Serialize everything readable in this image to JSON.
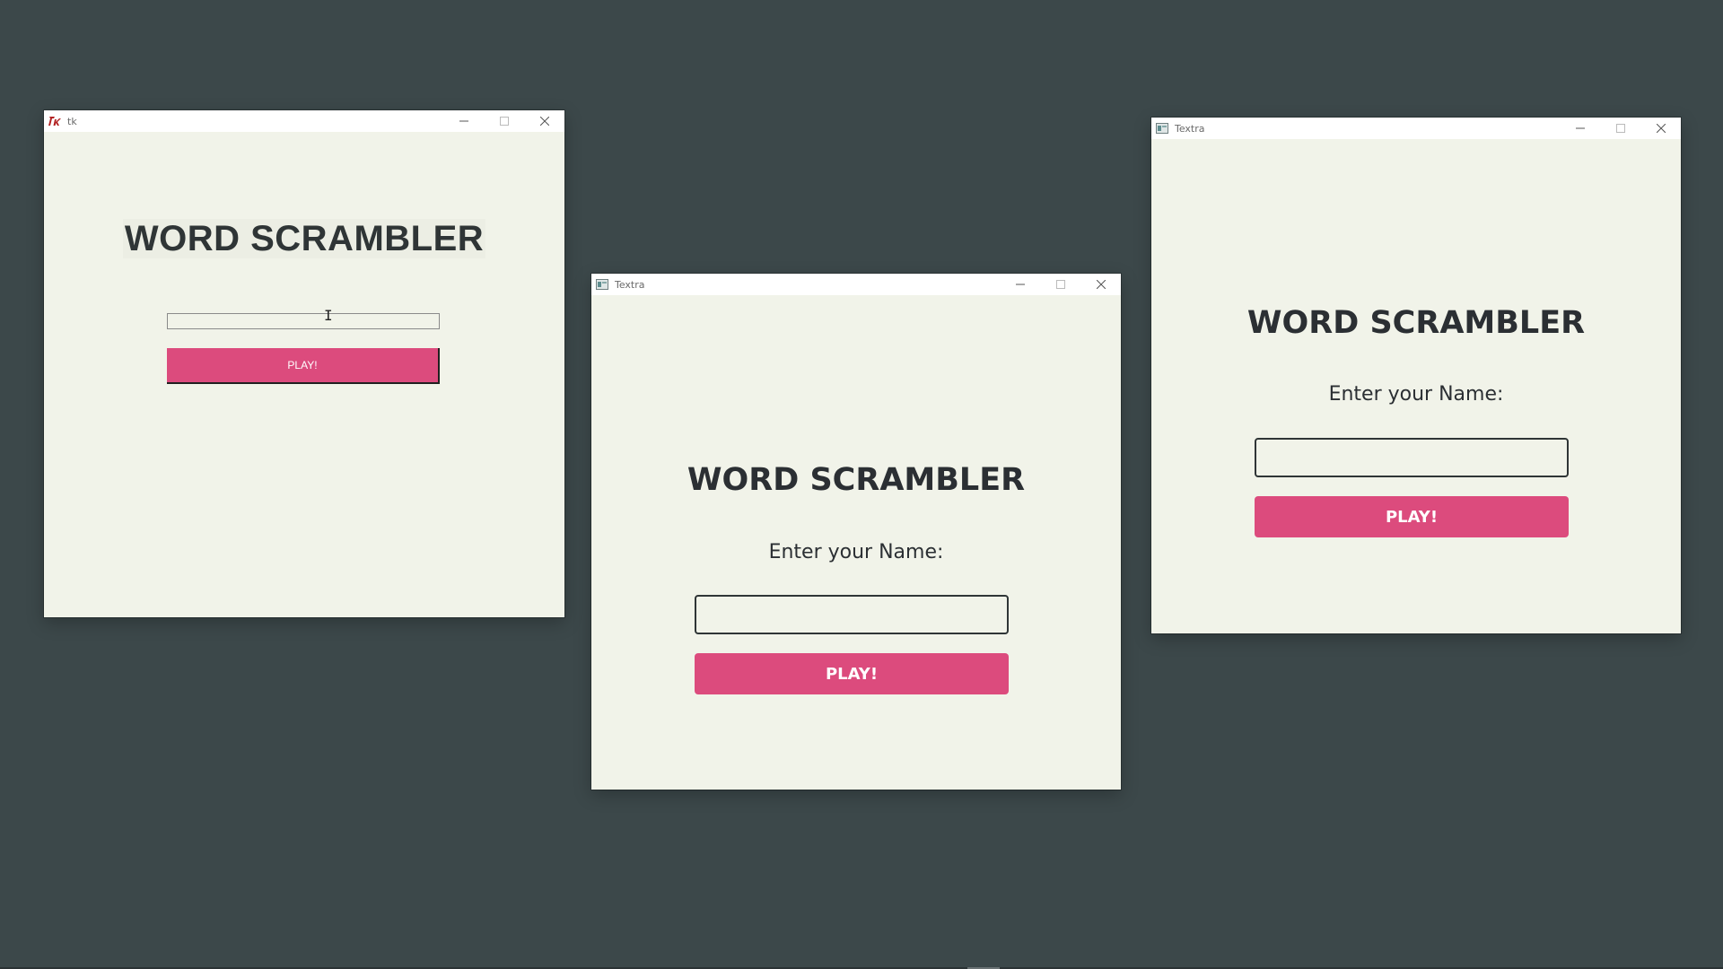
{
  "desktop": {
    "background_color": "#3c484a"
  },
  "windows": [
    {
      "id": "tk",
      "title": "tk",
      "icon": "tk-feather-icon",
      "heading": "WORD SCRAMBLER",
      "name_input": {
        "value": "",
        "placeholder": ""
      },
      "play_button_label": "PLAY!"
    },
    {
      "id": "textra-1",
      "title": "Textra",
      "icon": "app-window-icon",
      "heading": "WORD SCRAMBLER",
      "prompt": "Enter your Name:",
      "name_input": {
        "value": "",
        "placeholder": ""
      },
      "play_button_label": "PLAY!"
    },
    {
      "id": "textra-2",
      "title": "Textra",
      "icon": "app-window-icon",
      "heading": "WORD SCRAMBLER",
      "prompt": "Enter your Name:",
      "name_input": {
        "value": "",
        "placeholder": ""
      },
      "play_button_label": "PLAY!"
    }
  ],
  "colors": {
    "window_bg": "#f1f3e9",
    "button_accent": "#dc4b7d",
    "heading_text": "#2b2f33",
    "titlebar_bg": "#ffffff"
  },
  "window_controls": {
    "minimize_icon": "minimize-icon",
    "maximize_icon": "maximize-icon",
    "close_icon": "close-icon"
  }
}
